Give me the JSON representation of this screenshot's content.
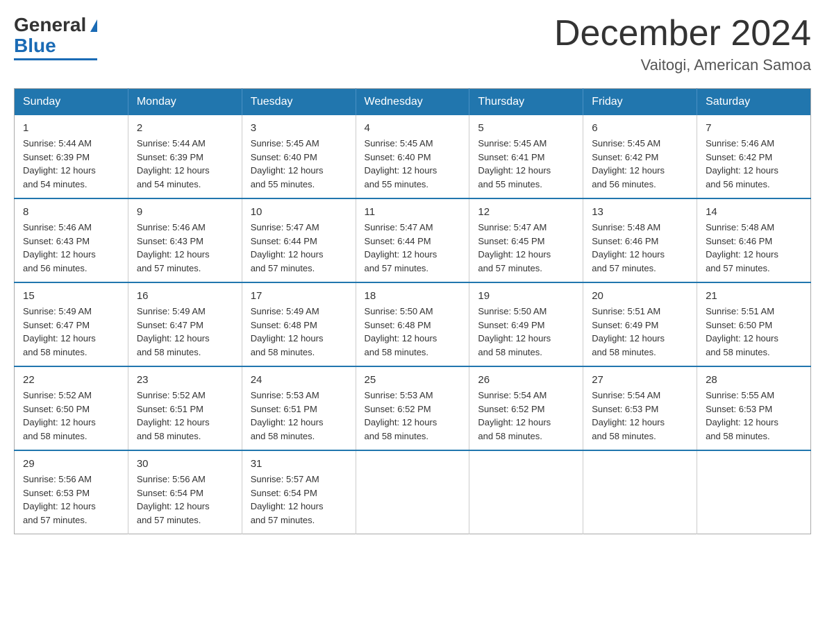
{
  "header": {
    "logo_general": "General",
    "logo_blue": "Blue",
    "month_title": "December 2024",
    "location": "Vaitogi, American Samoa"
  },
  "days_of_week": [
    "Sunday",
    "Monday",
    "Tuesday",
    "Wednesday",
    "Thursday",
    "Friday",
    "Saturday"
  ],
  "weeks": [
    [
      {
        "day": "1",
        "sunrise": "5:44 AM",
        "sunset": "6:39 PM",
        "daylight_h": "12",
        "daylight_m": "54"
      },
      {
        "day": "2",
        "sunrise": "5:44 AM",
        "sunset": "6:39 PM",
        "daylight_h": "12",
        "daylight_m": "54"
      },
      {
        "day": "3",
        "sunrise": "5:45 AM",
        "sunset": "6:40 PM",
        "daylight_h": "12",
        "daylight_m": "55"
      },
      {
        "day": "4",
        "sunrise": "5:45 AM",
        "sunset": "6:40 PM",
        "daylight_h": "12",
        "daylight_m": "55"
      },
      {
        "day": "5",
        "sunrise": "5:45 AM",
        "sunset": "6:41 PM",
        "daylight_h": "12",
        "daylight_m": "55"
      },
      {
        "day": "6",
        "sunrise": "5:45 AM",
        "sunset": "6:42 PM",
        "daylight_h": "12",
        "daylight_m": "56"
      },
      {
        "day": "7",
        "sunrise": "5:46 AM",
        "sunset": "6:42 PM",
        "daylight_h": "12",
        "daylight_m": "56"
      }
    ],
    [
      {
        "day": "8",
        "sunrise": "5:46 AM",
        "sunset": "6:43 PM",
        "daylight_h": "12",
        "daylight_m": "56"
      },
      {
        "day": "9",
        "sunrise": "5:46 AM",
        "sunset": "6:43 PM",
        "daylight_h": "12",
        "daylight_m": "57"
      },
      {
        "day": "10",
        "sunrise": "5:47 AM",
        "sunset": "6:44 PM",
        "daylight_h": "12",
        "daylight_m": "57"
      },
      {
        "day": "11",
        "sunrise": "5:47 AM",
        "sunset": "6:44 PM",
        "daylight_h": "12",
        "daylight_m": "57"
      },
      {
        "day": "12",
        "sunrise": "5:47 AM",
        "sunset": "6:45 PM",
        "daylight_h": "12",
        "daylight_m": "57"
      },
      {
        "day": "13",
        "sunrise": "5:48 AM",
        "sunset": "6:46 PM",
        "daylight_h": "12",
        "daylight_m": "57"
      },
      {
        "day": "14",
        "sunrise": "5:48 AM",
        "sunset": "6:46 PM",
        "daylight_h": "12",
        "daylight_m": "57"
      }
    ],
    [
      {
        "day": "15",
        "sunrise": "5:49 AM",
        "sunset": "6:47 PM",
        "daylight_h": "12",
        "daylight_m": "58"
      },
      {
        "day": "16",
        "sunrise": "5:49 AM",
        "sunset": "6:47 PM",
        "daylight_h": "12",
        "daylight_m": "58"
      },
      {
        "day": "17",
        "sunrise": "5:49 AM",
        "sunset": "6:48 PM",
        "daylight_h": "12",
        "daylight_m": "58"
      },
      {
        "day": "18",
        "sunrise": "5:50 AM",
        "sunset": "6:48 PM",
        "daylight_h": "12",
        "daylight_m": "58"
      },
      {
        "day": "19",
        "sunrise": "5:50 AM",
        "sunset": "6:49 PM",
        "daylight_h": "12",
        "daylight_m": "58"
      },
      {
        "day": "20",
        "sunrise": "5:51 AM",
        "sunset": "6:49 PM",
        "daylight_h": "12",
        "daylight_m": "58"
      },
      {
        "day": "21",
        "sunrise": "5:51 AM",
        "sunset": "6:50 PM",
        "daylight_h": "12",
        "daylight_m": "58"
      }
    ],
    [
      {
        "day": "22",
        "sunrise": "5:52 AM",
        "sunset": "6:50 PM",
        "daylight_h": "12",
        "daylight_m": "58"
      },
      {
        "day": "23",
        "sunrise": "5:52 AM",
        "sunset": "6:51 PM",
        "daylight_h": "12",
        "daylight_m": "58"
      },
      {
        "day": "24",
        "sunrise": "5:53 AM",
        "sunset": "6:51 PM",
        "daylight_h": "12",
        "daylight_m": "58"
      },
      {
        "day": "25",
        "sunrise": "5:53 AM",
        "sunset": "6:52 PM",
        "daylight_h": "12",
        "daylight_m": "58"
      },
      {
        "day": "26",
        "sunrise": "5:54 AM",
        "sunset": "6:52 PM",
        "daylight_h": "12",
        "daylight_m": "58"
      },
      {
        "day": "27",
        "sunrise": "5:54 AM",
        "sunset": "6:53 PM",
        "daylight_h": "12",
        "daylight_m": "58"
      },
      {
        "day": "28",
        "sunrise": "5:55 AM",
        "sunset": "6:53 PM",
        "daylight_h": "12",
        "daylight_m": "58"
      }
    ],
    [
      {
        "day": "29",
        "sunrise": "5:56 AM",
        "sunset": "6:53 PM",
        "daylight_h": "12",
        "daylight_m": "57"
      },
      {
        "day": "30",
        "sunrise": "5:56 AM",
        "sunset": "6:54 PM",
        "daylight_h": "12",
        "daylight_m": "57"
      },
      {
        "day": "31",
        "sunrise": "5:57 AM",
        "sunset": "6:54 PM",
        "daylight_h": "12",
        "daylight_m": "57"
      },
      null,
      null,
      null,
      null
    ]
  ]
}
